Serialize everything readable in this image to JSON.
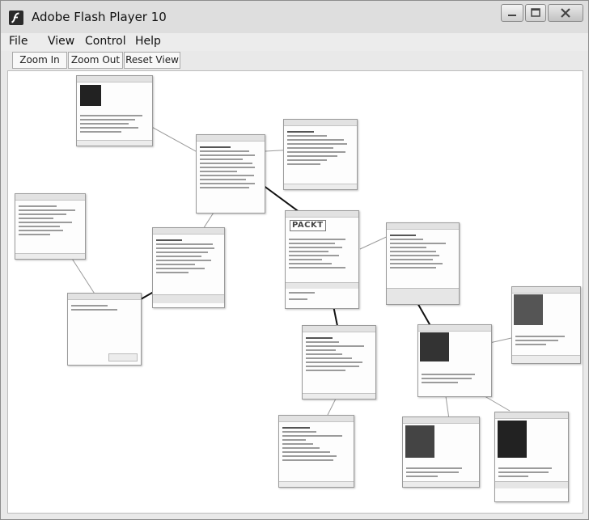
{
  "window": {
    "title": "Adobe Flash Player 10",
    "controls": [
      "minimize-icon",
      "maximize-icon",
      "close-icon"
    ]
  },
  "menu": {
    "items": [
      "File",
      "View",
      "Control",
      "Help"
    ]
  },
  "toolbar": {
    "zoom_in": "Zoom In",
    "zoom_out": "Zoom Out",
    "reset_view": "Reset View"
  },
  "graph": {
    "node_logo_text": "PACKT",
    "colors": {
      "edge": "#9a9a9a",
      "edge_strong": "#111111",
      "node_border": "#9a9a9a"
    }
  }
}
